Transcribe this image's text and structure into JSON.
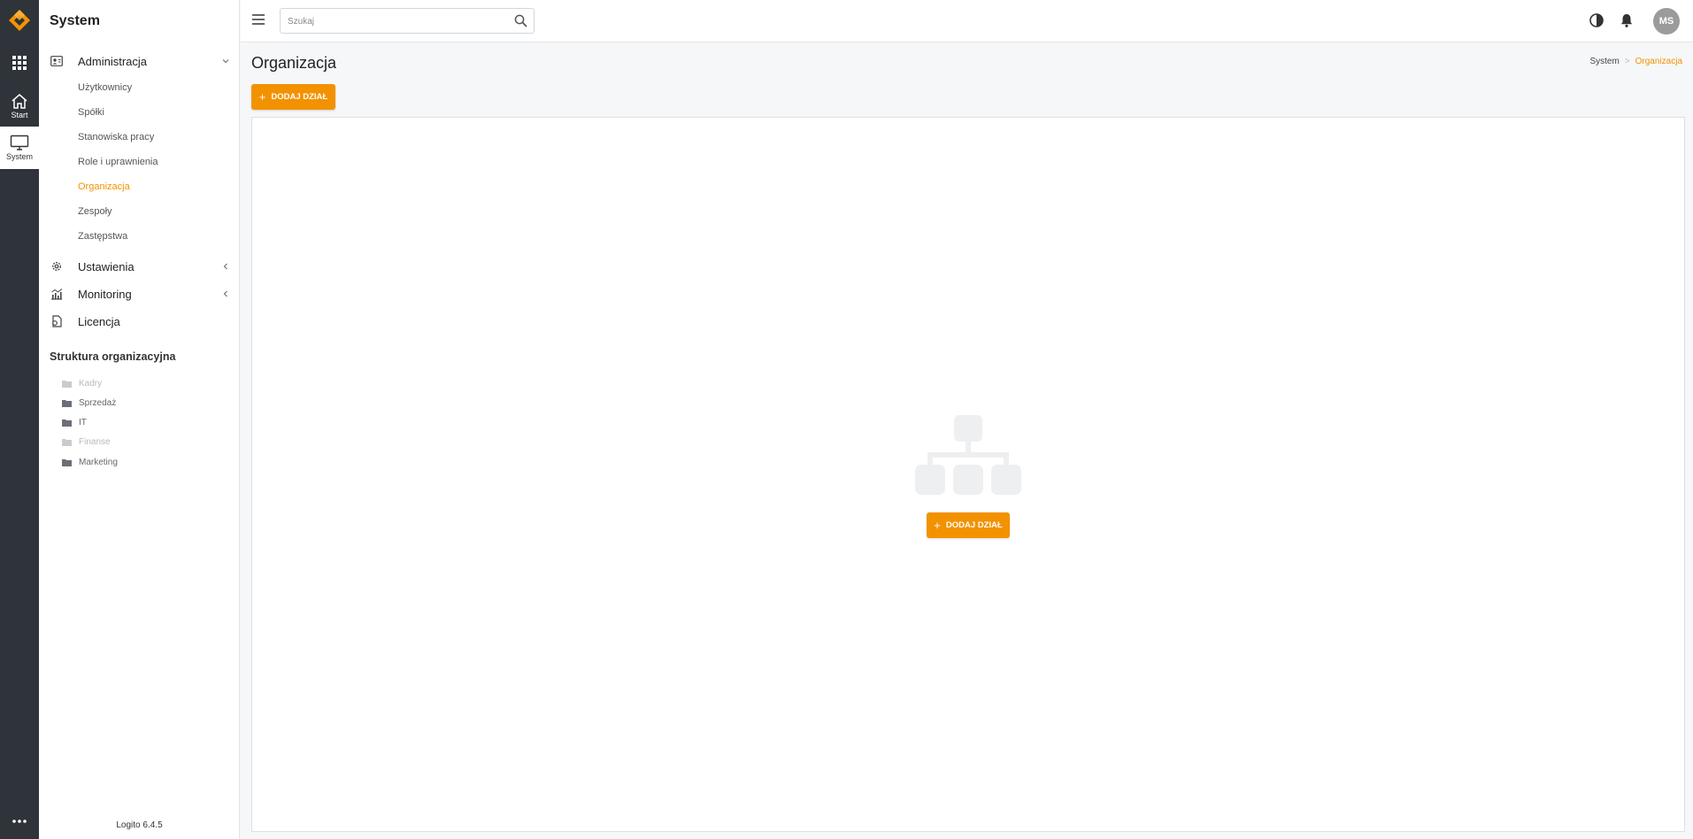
{
  "rail": {
    "start_label": "Start",
    "system_label": "System"
  },
  "sidebar": {
    "title": "System",
    "groups": [
      {
        "label": "Administracja",
        "icon": "user-card-icon",
        "expanded": true
      },
      {
        "label": "Ustawienia",
        "icon": "gear-icon",
        "expanded": false
      },
      {
        "label": "Monitoring",
        "icon": "chart-icon",
        "expanded": false
      },
      {
        "label": "Licencja",
        "icon": "license-icon"
      }
    ],
    "admin_items": [
      {
        "label": "Użytkownicy"
      },
      {
        "label": "Spółki"
      },
      {
        "label": "Stanowiska pracy"
      },
      {
        "label": "Role i uprawnienia"
      },
      {
        "label": "Organizacja",
        "active": true
      },
      {
        "label": "Zespoły"
      },
      {
        "label": "Zastępstwa"
      }
    ],
    "org_section_title": "Struktura organizacyjna",
    "tree": [
      {
        "label": "Kadry",
        "dimmed": true
      },
      {
        "label": "Sprzedaż",
        "dimmed": false
      },
      {
        "label": "IT",
        "dimmed": false
      },
      {
        "label": "Finanse",
        "dimmed": true
      },
      {
        "label": "Marketing",
        "dimmed": false
      }
    ],
    "version": "Logito 6.4.5"
  },
  "topbar": {
    "search_placeholder": "Szukaj",
    "avatar_initials": "MS"
  },
  "main": {
    "title": "Organizacja",
    "breadcrumb": {
      "root": "System",
      "separator": ">",
      "current": "Organizacja"
    },
    "add_button_label": "DODAJ DZIAŁ",
    "empty_add_button_label": "DODAJ DZIAŁ"
  },
  "colors": {
    "accent": "#f39200",
    "rail": "#2f333a"
  }
}
